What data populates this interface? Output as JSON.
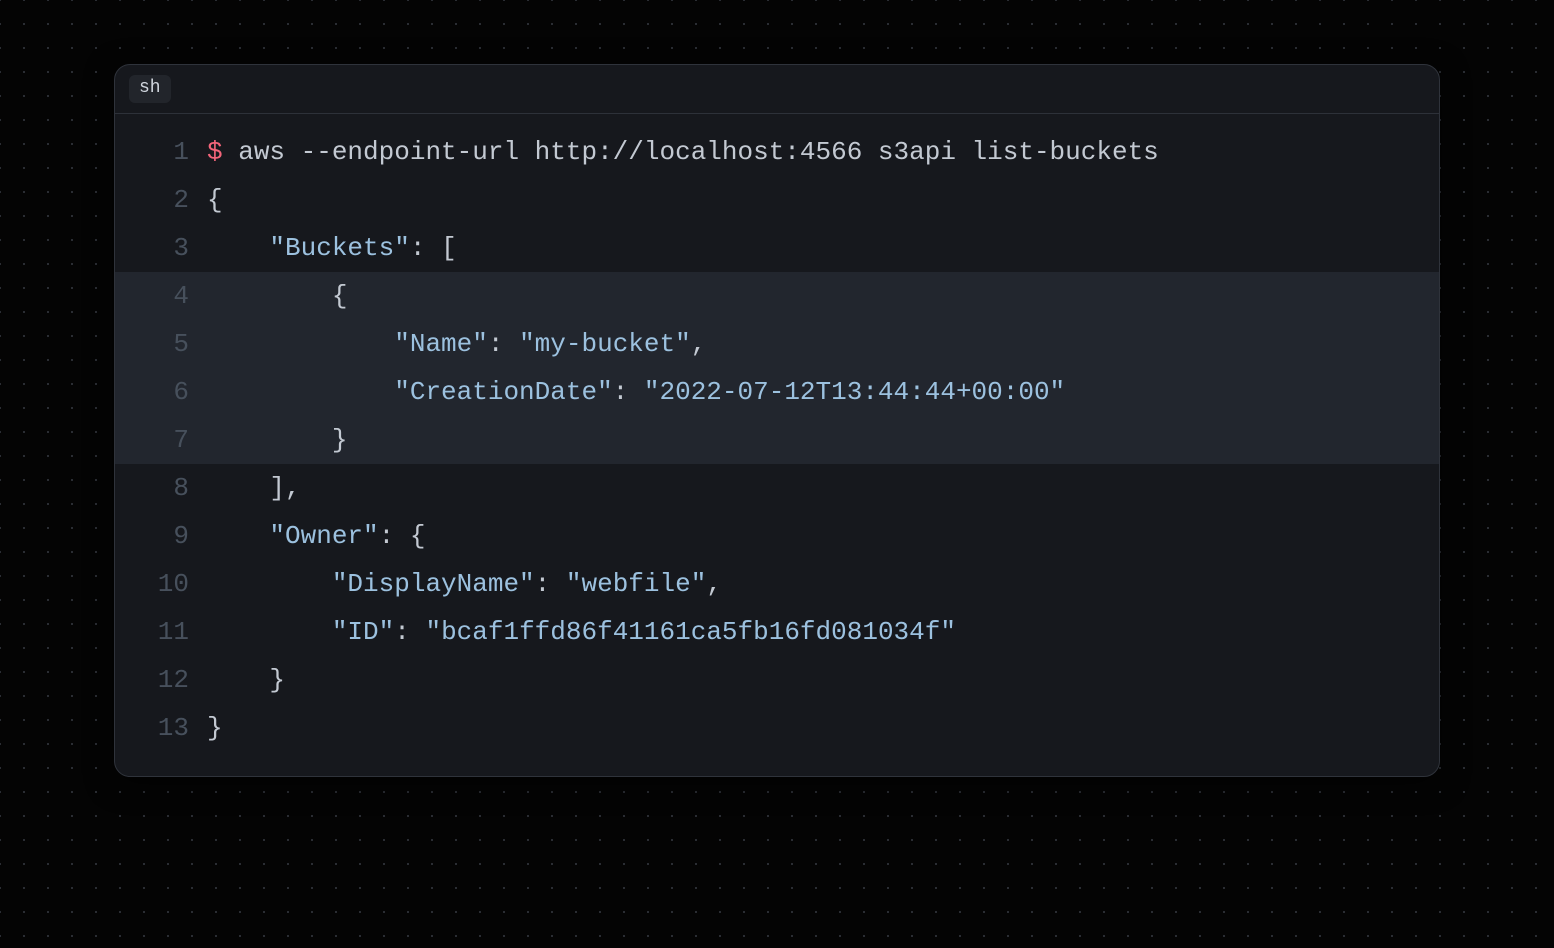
{
  "header": {
    "language_badge": "sh"
  },
  "code": {
    "prompt_symbol": "$",
    "command": "aws --endpoint-url http://localhost:4566 s3api list-buckets"
  },
  "json_output": {
    "keys": {
      "buckets": "\"Buckets\"",
      "name": "\"Name\"",
      "creation_date": "\"CreationDate\"",
      "owner": "\"Owner\"",
      "display_name": "\"DisplayName\"",
      "id": "\"ID\""
    },
    "values": {
      "name": "\"my-bucket\"",
      "creation_date": "\"2022-07-12T13:44:44+00:00\"",
      "display_name": "\"webfile\"",
      "id": "\"bcaf1ffd86f41161ca5fb16fd081034f\""
    }
  },
  "line_numbers": [
    "1",
    "2",
    "3",
    "4",
    "5",
    "6",
    "7",
    "8",
    "9",
    "10",
    "11",
    "12",
    "13"
  ]
}
